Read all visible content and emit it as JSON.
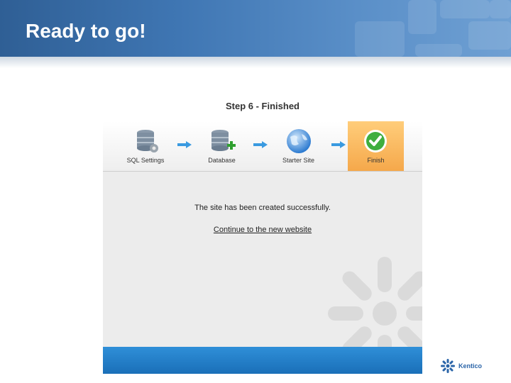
{
  "slide": {
    "title": "Ready to go!"
  },
  "wizard": {
    "step_title": "Step 6 - Finished",
    "steps": [
      {
        "label": "SQL Settings",
        "icon": "database-server-icon"
      },
      {
        "label": "Database",
        "icon": "database-add-icon"
      },
      {
        "label": "Starter Site",
        "icon": "globe-icon"
      },
      {
        "label": "Finish",
        "icon": "checkmark-icon"
      }
    ],
    "message": "The site has been created successfully.",
    "continue_link": "Continue to the new website"
  },
  "logo": {
    "text": "Kentico"
  },
  "colors": {
    "header": "#3f76b3",
    "active_step": "#f5a84b",
    "bottom_bar": "#1a6fb8"
  }
}
